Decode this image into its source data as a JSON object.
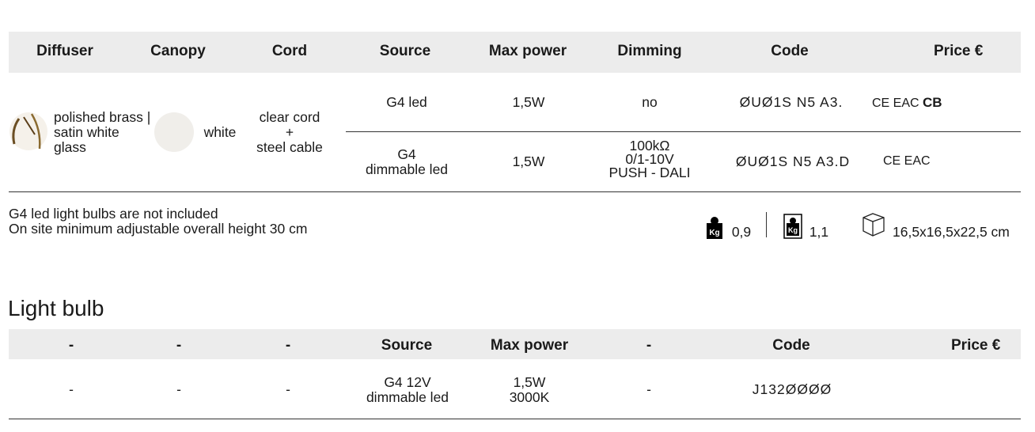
{
  "product_table": {
    "headers": {
      "diffuser": "Diffuser",
      "canopy": "Canopy",
      "cord": "Cord",
      "source": "Source",
      "max_power": "Max power",
      "dimming": "Dimming",
      "code": "Code",
      "price": "Price €"
    },
    "finish": {
      "diffuser_label_1": "polished brass |",
      "diffuser_label_2": "satin white",
      "diffuser_label_3": "glass",
      "canopy_label": "white",
      "cord_label_1": "clear cord",
      "cord_label_2": "+",
      "cord_label_3": "steel cable"
    },
    "rows": [
      {
        "source": "G4 led",
        "max_power": "1,5W",
        "dimming": "no",
        "code": "ØUØ1S N5 A3.",
        "certs": "CE EAC",
        "cert_cb": "CB"
      },
      {
        "source_1": "G4",
        "source_2": "dimmable led",
        "max_power": "1,5W",
        "dimming_1": "100kΩ",
        "dimming_2": "0/1-10V",
        "dimming_3": "PUSH - DALI",
        "code": "ØUØ1S N5 A3.D",
        "certs": "CE EAC"
      }
    ],
    "notes": {
      "line_1": "G4 led light bulbs are not included",
      "line_2": "On site minimum adjustable overall height 30 cm"
    },
    "specs": {
      "net_weight": "0,9",
      "gross_weight": "1,1",
      "package_size": "16,5x16,5x22,5 cm",
      "kg_icon_text": "Kg"
    }
  },
  "light_bulb": {
    "title": "Light bulb",
    "headers": {
      "col1": "-",
      "col2": "-",
      "col3": "-",
      "source": "Source",
      "max_power": "Max power",
      "dimming": "-",
      "code": "Code",
      "price": "Price €"
    },
    "row": {
      "col1": "-",
      "col2": "-",
      "col3": "-",
      "source_1": "G4 12V",
      "source_2": "dimmable led",
      "power_1": "1,5W",
      "power_2": "3000K",
      "dimming": "-",
      "code": "J132ØØØØ"
    }
  },
  "colors": {
    "header_bg": "#ececec",
    "rule": "#333333",
    "canopy_swatch": "#f0eeea"
  }
}
